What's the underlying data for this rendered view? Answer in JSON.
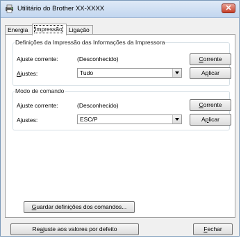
{
  "window": {
    "title": "Utilitário do Brother XX-XXXX",
    "close_label": "✕"
  },
  "tabs": [
    {
      "label": "Energia",
      "active": false
    },
    {
      "label": "Impressão",
      "active": true
    },
    {
      "label": "Ligação",
      "active": false
    }
  ],
  "info_group": {
    "title": "Definições da Impressão das Informações da Impressora",
    "current_label": "Ajuste corrente:",
    "current_value": "(Desconhecido)",
    "current_button_first": "C",
    "current_button_rest": "orrente",
    "settings_label_first": "A",
    "settings_label_rest": "justes:",
    "settings_value": "Tudo",
    "apply_button_first": "A",
    "apply_button_mid": "p",
    "apply_button_rest": "licar"
  },
  "command_group": {
    "title": "Modo de comando",
    "current_label": "Ajuste corrente:",
    "current_value": "(Desconhecido)",
    "current_button_first": "C",
    "current_button_rest": "orrente",
    "settings_label": "Ajustes:",
    "settings_value": "ESC/P",
    "apply_button_first": "A",
    "apply_button_mid": "p",
    "apply_button_rest": "licar"
  },
  "save_button": {
    "first": "G",
    "rest": "uardar definições dos comandos..."
  },
  "reset_button": {
    "pre": "Re",
    "accel": "a",
    "rest": "juste aos valores por defeito"
  },
  "close_button": {
    "first": "F",
    "rest": "echar"
  }
}
